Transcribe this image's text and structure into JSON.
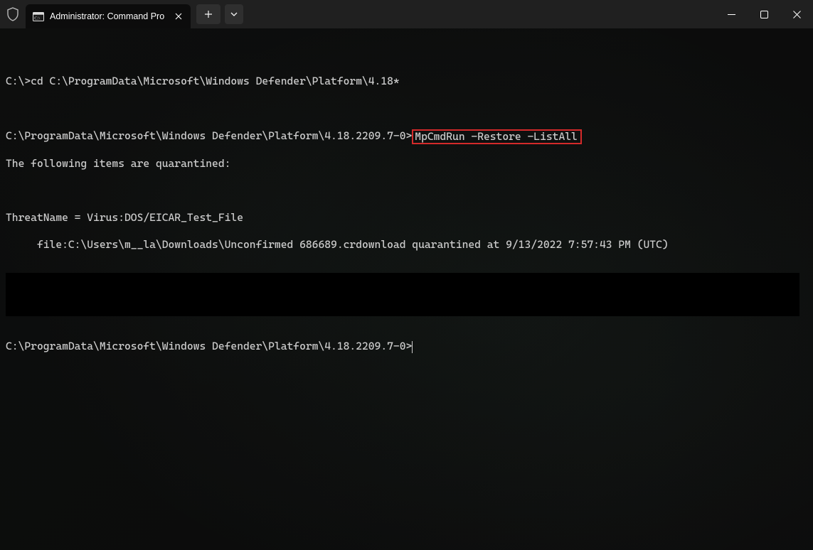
{
  "titlebar": {
    "tab_title": "Administrator: Command Pro"
  },
  "terminal": {
    "line1_prompt": "C:\\>",
    "line1_cmd": "cd C:\\ProgramData\\Microsoft\\Windows Defender\\Platform\\4.18*",
    "line2_prompt": "C:\\ProgramData\\Microsoft\\Windows Defender\\Platform\\4.18.2209.7-0>",
    "line2_cmd_highlighted": "MpCmdRun -Restore -ListAll",
    "line3": "The following items are quarantined:",
    "line4": "ThreatName = Virus:DOS/EICAR_Test_File",
    "line5": "     file:C:\\Users\\m__la\\Downloads\\Unconfirmed 686689.crdownload quarantined at 9/13/2022 7:57:43 PM (UTC)",
    "line6_prompt": "C:\\ProgramData\\Microsoft\\Windows Defender\\Platform\\4.18.2209.7-0>"
  }
}
